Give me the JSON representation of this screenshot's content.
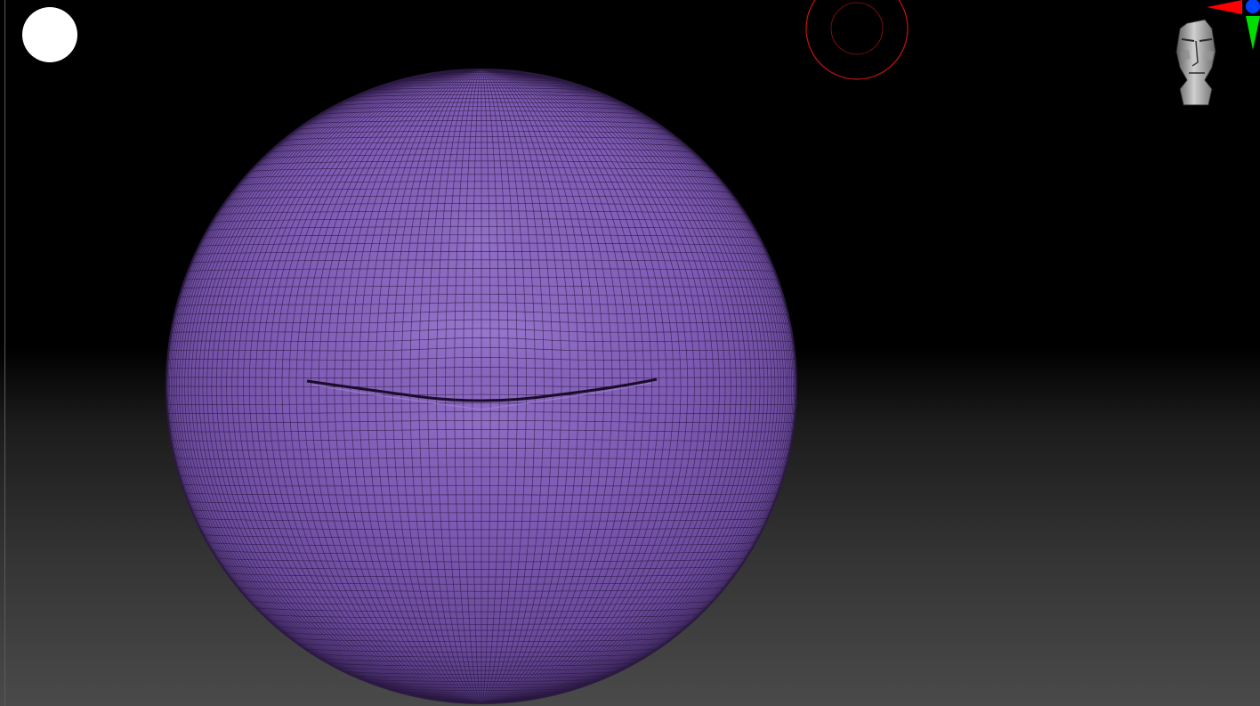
{
  "viewport": {
    "background_top": "#000000",
    "background_bottom": "#4a4a4a"
  },
  "model": {
    "base_color": "#7d5ab3",
    "highlight_color": "#9372c8",
    "shadow_color": "#4f3577",
    "wire_color": "#2a1840",
    "feature": "mouth-lips"
  },
  "color_swatch": {
    "color": "#ffffff"
  },
  "brush_cursor": {
    "outer_color": "#cc1111",
    "inner_color": "#991111"
  },
  "nav_head": {
    "icon": "navigation-head-icon"
  },
  "axis_gizmo": {
    "x_color": "#ff0000",
    "y_color": "#00dd00",
    "z_color": "#0044ff"
  }
}
